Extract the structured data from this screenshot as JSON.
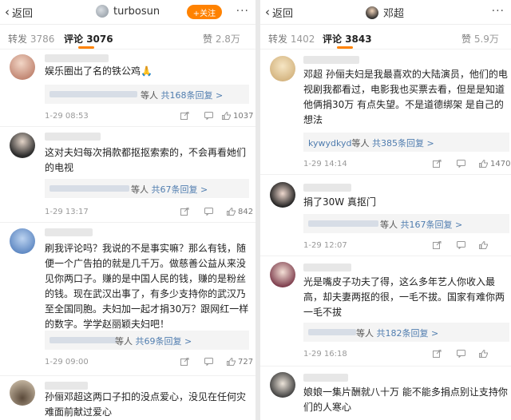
{
  "left": {
    "back_label": "返回",
    "account_name": "turbosun",
    "follow_label": "+关注",
    "more_label": "···",
    "tabs": {
      "repost_label": "转发",
      "repost_count": "3786",
      "comment_label": "评论",
      "comment_count": "3076",
      "like_label": "赞",
      "like_count": "2.8万"
    },
    "comments": [
      {
        "text": "娱乐圈出了名的铁公鸡🙏",
        "reply_prefix": "等人",
        "reply_link": "共168条回复 >",
        "time": "1-29 08:53",
        "likes": "1037"
      },
      {
        "text": "这对夫妇每次捐款都抠抠索索的，不会再看她们的电视",
        "reply_prefix": "等人",
        "reply_link": "共67条回复 >",
        "time": "1-29 13:17",
        "likes": "842"
      },
      {
        "text": "刷我评论吗？我说的不是事实嘛？那么有钱，随便一个广告拍的就是几千万。做慈善公益从来没见你两口子。赚的是中国人民的钱，赚的是粉丝的钱。现在武汉出事了，有多少支持你的武汉乃至全国同胞。夫妇加一起才捐30万？跟网红一样的数字。学学赵丽颖夫妇吧！",
        "reply_prefix": "等人",
        "reply_link": "共69条回复 >",
        "time": "1-29 09:00",
        "likes": "727"
      },
      {
        "text": "孙俪邓超这两口子扣的没点爱心，没见在任何灾难面前献过爱心"
      }
    ]
  },
  "right": {
    "back_label": "返回",
    "account_name": "邓超",
    "more_label": "···",
    "tabs": {
      "repost_label": "转发",
      "repost_count": "1402",
      "comment_label": "评论",
      "comment_count": "3843",
      "like_label": "赞",
      "like_count": "5.9万"
    },
    "comments": [
      {
        "text": "邓超 孙俪夫妇是我最喜欢的大陆演员，他们的电视剧我都看过，电影我也买票去看，但是是知道他俩捐30万 有点失望。不是道德绑架 是自己的想法",
        "reply_user": "kywydkyd",
        "reply_prefix": "等人",
        "reply_link": "共385条回复 >",
        "time": "1-29 14:14",
        "likes": "1470"
      },
      {
        "text": "捐了30W 真抠门",
        "reply_prefix": "等人",
        "reply_link": "共167条回复 >",
        "time": "1-29 12:07"
      },
      {
        "text": "光是嘴皮子功夫了得，这么多年艺人你收入最高，却夫妻两抠的很，一毛不拔。国家有难你两一毛不拔",
        "reply_prefix": "等人",
        "reply_link": "共182条回复 >",
        "time": "1-29 16:18"
      },
      {
        "text": "娘娘一集片酬就八十万 能不能多捐点别让支持你们的人寒心"
      }
    ]
  },
  "colors": {
    "accent": "#ff8200",
    "link": "#507daf"
  },
  "icons": [
    "back-chevron-icon",
    "more-dots-icon",
    "share-icon",
    "comment-icon",
    "like-thumb-icon"
  ]
}
